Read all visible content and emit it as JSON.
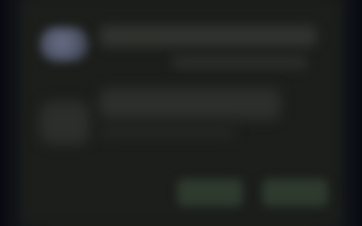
{
  "dialog": {
    "title": "",
    "subtitle": "",
    "message": "",
    "secondary_button_label": "",
    "primary_button_label": ""
  },
  "colors": {
    "background": "#111411",
    "dialog_surface": "#1b1e1a",
    "button_fill": "#2f3a2f",
    "avatar_tint": "#5a5f78"
  },
  "icons": {
    "header": "avatar",
    "body": "app-icon"
  }
}
